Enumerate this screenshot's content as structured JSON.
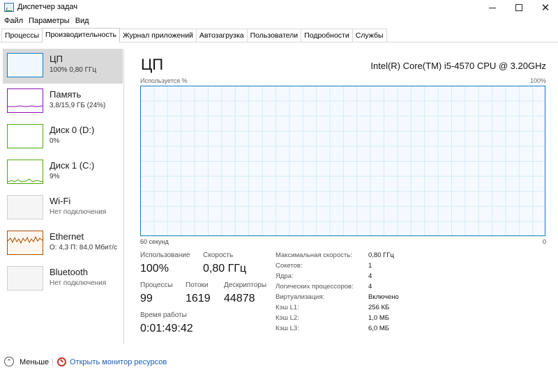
{
  "window": {
    "title": "Диспетчер задач",
    "icon": "task-manager-icon",
    "controls": [
      "minimize",
      "maximize",
      "close"
    ]
  },
  "menu": [
    "Файл",
    "Параметры",
    "Вид"
  ],
  "tabs": [
    "Процессы",
    "Производительность",
    "Журнал приложений",
    "Автозагрузка",
    "Пользователи",
    "Подробности",
    "Службы"
  ],
  "active_tab": "Производительность",
  "sidebar": {
    "items": [
      {
        "name": "ЦП",
        "sub": "100% 0,80 ГГц",
        "color": "#117dbb"
      },
      {
        "name": "Память",
        "sub": "3,8/15,9 ГБ (24%)",
        "color": "#8b12ae"
      },
      {
        "name": "Диск 0 (D:)",
        "sub": "0%",
        "color": "#4da60c"
      },
      {
        "name": "Диск 1 (C:)",
        "sub": "9%",
        "color": "#4da60c"
      },
      {
        "name": "Wi-Fi",
        "sub": "Нет подключения",
        "color": "#a74f01"
      },
      {
        "name": "Ethernet",
        "sub": "О: 4,3  П: 84,0 Мбит/с",
        "color": "#a74f01"
      },
      {
        "name": "Bluetooth",
        "sub": "Нет подключения",
        "color": "#a74f01"
      }
    ]
  },
  "cpu": {
    "title": "ЦП",
    "model": "Intel(R) Core(TM) i5-4570 CPU @ 3.20GHz",
    "graph_label": "Используется %",
    "graph_max": "100%",
    "time_left": "60 секунд",
    "time_right": "0",
    "stats": {
      "usage_label": "Использование",
      "usage_value": "100%",
      "speed_label": "Скорость",
      "speed_value": "0,80 ГГц",
      "processes_label": "Процессы",
      "processes_value": "99",
      "threads_label": "Потоки",
      "threads_value": "1619",
      "handles_label": "Дескрипторы",
      "handles_value": "44878",
      "uptime_label": "Время работы",
      "uptime_value": "0:01:49:42"
    },
    "specs": [
      {
        "key": "Максимальная скорость:",
        "value": "0,80 ГГц"
      },
      {
        "key": "Сокетов:",
        "value": "1"
      },
      {
        "key": "Ядра:",
        "value": "4"
      },
      {
        "key": "Логических процессоров:",
        "value": "4"
      },
      {
        "key": "Виртуализация:",
        "value": "Включено"
      },
      {
        "key": "Кэш L1:",
        "value": "256 КБ"
      },
      {
        "key": "Кэш L2:",
        "value": "1,0 МБ"
      },
      {
        "key": "Кэш L3:",
        "value": "6,0 МБ"
      }
    ]
  },
  "footer": {
    "fewer_label": "Меньше",
    "monitor_label": "Открыть монитор ресурсов"
  }
}
